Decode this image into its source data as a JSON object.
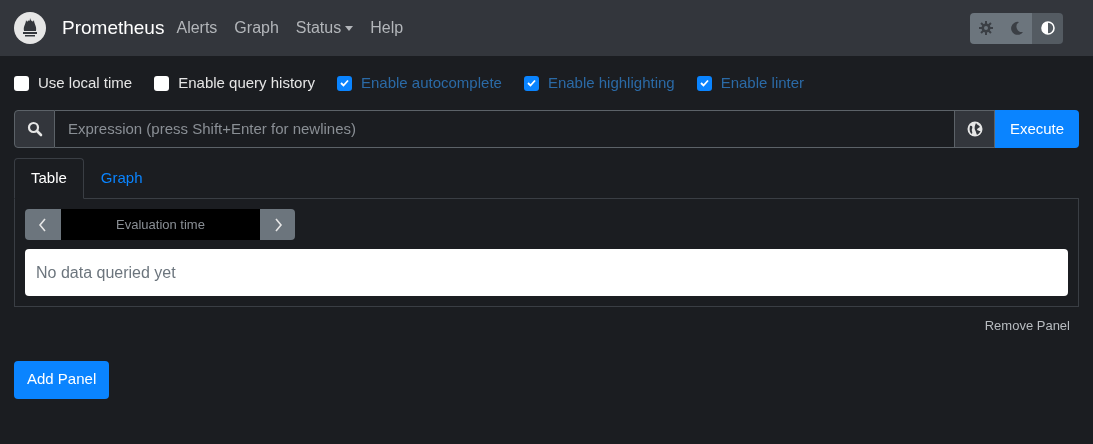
{
  "navbar": {
    "brand": "Prometheus",
    "links": [
      {
        "label": "Alerts",
        "dropdown": false
      },
      {
        "label": "Graph",
        "dropdown": false
      },
      {
        "label": "Status",
        "dropdown": true
      },
      {
        "label": "Help",
        "dropdown": false
      }
    ],
    "theme_buttons": [
      {
        "kind": "light",
        "selected": false
      },
      {
        "kind": "dark",
        "selected": false
      },
      {
        "kind": "auto",
        "selected": true
      }
    ]
  },
  "options": [
    {
      "label": "Use local time",
      "checked": false
    },
    {
      "label": "Enable query history",
      "checked": false
    },
    {
      "label": "Enable autocomplete",
      "checked": true
    },
    {
      "label": "Enable highlighting",
      "checked": true
    },
    {
      "label": "Enable linter",
      "checked": true
    }
  ],
  "query": {
    "placeholder": "Expression (press Shift+Enter for newlines)",
    "execute": "Execute"
  },
  "panel": {
    "tabs": [
      {
        "label": "Table",
        "selected": true
      },
      {
        "label": "Graph",
        "selected": false
      }
    ],
    "evaluation_time": {
      "placeholder": "Evaluation time"
    },
    "message": "No data queried yet",
    "remove": "Remove Panel"
  },
  "add_panel": "Add Panel"
}
